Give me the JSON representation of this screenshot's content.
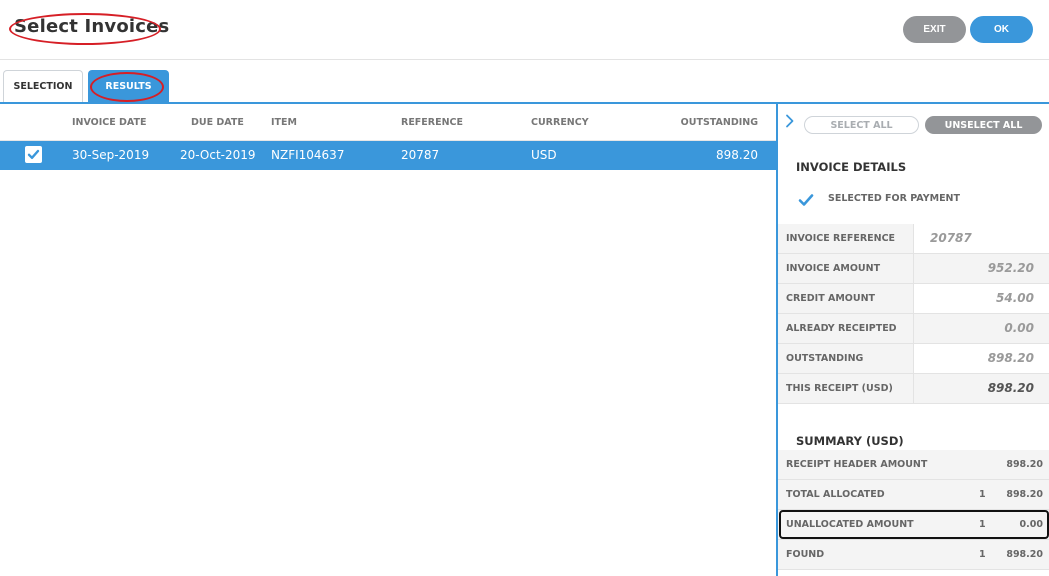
{
  "header": {
    "title": "Select Invoices",
    "exit_label": "EXIT",
    "ok_label": "OK"
  },
  "tabs": [
    {
      "label": "SELECTION"
    },
    {
      "label": "RESULTS",
      "active": true
    }
  ],
  "grid": {
    "columns": [
      "INVOICE DATE",
      "DUE DATE",
      "ITEM",
      "REFERENCE",
      "CURRENCY",
      "OUTSTANDING"
    ],
    "rows": [
      {
        "selected": true,
        "invoice_date": "30-Sep-2019",
        "due_date": "20-Oct-2019",
        "item": "NZFI104637",
        "reference": "20787",
        "currency": "USD",
        "outstanding": "898.20"
      }
    ]
  },
  "panel": {
    "select_all_label": "SELECT ALL",
    "unselect_all_label": "UNSELECT ALL",
    "invoice_details": {
      "title": "INVOICE DETAILS",
      "selected_for_payment_label": "SELECTED FOR PAYMENT",
      "rows": [
        {
          "label": "INVOICE REFERENCE",
          "value": "20787"
        },
        {
          "label": "INVOICE AMOUNT",
          "value": "952.20"
        },
        {
          "label": "CREDIT AMOUNT",
          "value": "54.00"
        },
        {
          "label": "ALREADY RECEIPTED",
          "value": "0.00"
        },
        {
          "label": "OUTSTANDING",
          "value": "898.20"
        },
        {
          "label": "THIS RECEIPT (USD)",
          "value": "898.20"
        }
      ]
    },
    "summary": {
      "title": "SUMMARY (USD)",
      "rows": [
        {
          "label": "RECEIPT HEADER AMOUNT",
          "count": "",
          "amount": "898.20"
        },
        {
          "label": "TOTAL ALLOCATED",
          "count": "1",
          "amount": "898.20"
        },
        {
          "label": "UNALLOCATED AMOUNT",
          "count": "1",
          "amount": "0.00"
        },
        {
          "label": "FOUND",
          "count": "1",
          "amount": "898.20"
        }
      ]
    }
  },
  "colors": {
    "accent": "#3a97db",
    "button_grey": "#939598",
    "annotation_red": "#d61f26"
  }
}
